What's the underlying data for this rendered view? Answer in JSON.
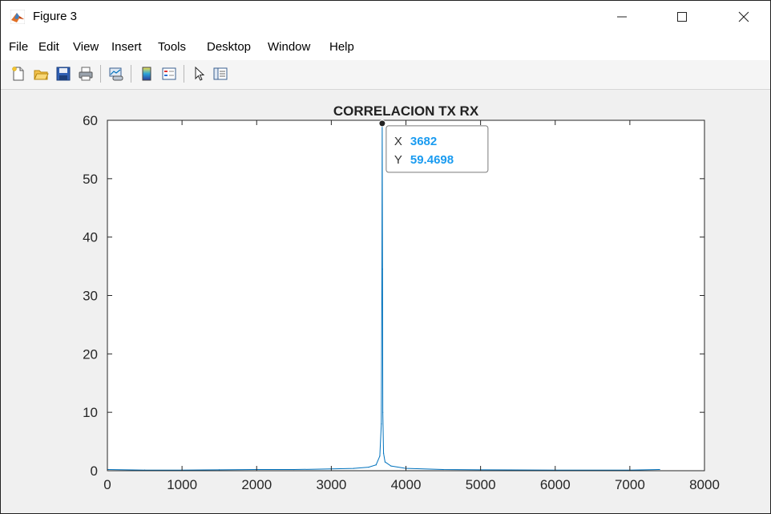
{
  "window": {
    "title": "Figure 3",
    "controls": {
      "minimize": "—",
      "maximize": "☐",
      "close": "✕"
    }
  },
  "menu": {
    "items": [
      "File",
      "Edit",
      "View",
      "Insert",
      "Tools",
      "Desktop",
      "Window",
      "Help"
    ]
  },
  "toolbar": {
    "buttons": [
      {
        "icon": "new-figure-icon"
      },
      {
        "icon": "open-file-icon"
      },
      {
        "icon": "save-icon"
      },
      {
        "icon": "print-icon"
      },
      {
        "icon": "link-plot-icon"
      },
      {
        "icon": "insert-colorbar-icon"
      },
      {
        "icon": "insert-legend-icon"
      },
      {
        "icon": "edit-plot-arrow-icon"
      },
      {
        "icon": "property-inspector-icon"
      }
    ]
  },
  "colors": {
    "line": "#0072BD",
    "datatip_value": "#1A9BF0",
    "axes_bg": "#ffffff",
    "figure_bg": "#f0f0f0"
  },
  "chart_data": {
    "type": "line",
    "title": "CORRELACION TX RX",
    "xlabel": "",
    "ylabel": "",
    "xlim": [
      0,
      8000
    ],
    "ylim": [
      0,
      60
    ],
    "xticks": [
      0,
      1000,
      2000,
      3000,
      4000,
      5000,
      6000,
      7000,
      8000
    ],
    "yticks": [
      0,
      10,
      20,
      30,
      40,
      50,
      60
    ],
    "grid": false,
    "series": [
      {
        "color": "#0072BD",
        "points": [
          [
            0,
            0.2
          ],
          [
            500,
            0.1
          ],
          [
            1000,
            0.1
          ],
          [
            1500,
            0.15
          ],
          [
            2000,
            0.2
          ],
          [
            2500,
            0.2
          ],
          [
            3000,
            0.3
          ],
          [
            3300,
            0.4
          ],
          [
            3500,
            0.6
          ],
          [
            3600,
            1.0
          ],
          [
            3650,
            2.5
          ],
          [
            3670,
            8
          ],
          [
            3678,
            34.5
          ],
          [
            3682,
            59.4698
          ],
          [
            3686,
            34.5
          ],
          [
            3690,
            10
          ],
          [
            3700,
            3
          ],
          [
            3720,
            1.5
          ],
          [
            3800,
            0.8
          ],
          [
            4000,
            0.4
          ],
          [
            4500,
            0.2
          ],
          [
            5000,
            0.15
          ],
          [
            6000,
            0.1
          ],
          [
            7000,
            0.1
          ],
          [
            7400,
            0.2
          ]
        ]
      }
    ],
    "datatip": {
      "x_label": "X",
      "x_value": "3682",
      "y_label": "Y",
      "y_value": "59.4698",
      "x": 3682,
      "y": 59.4698
    }
  }
}
